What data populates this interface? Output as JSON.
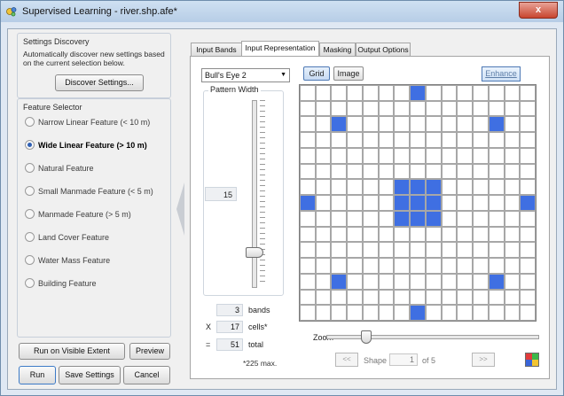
{
  "window": {
    "title": "Supervised Learning - river.shp.afe*",
    "close_label": "x"
  },
  "settings_discovery": {
    "title": "Settings Discovery",
    "description": "Automatically discover new settings based on the current selection below.",
    "button": "Discover Settings..."
  },
  "feature_selector": {
    "title": "Feature Selector",
    "items": [
      {
        "label": "Narrow Linear Feature (< 10 m)",
        "selected": false
      },
      {
        "label": "Wide Linear Feature (> 10 m)",
        "selected": true
      },
      {
        "label": "Natural Feature",
        "selected": false
      },
      {
        "label": "Small Manmade Feature (< 5 m)",
        "selected": false
      },
      {
        "label": "Manmade Feature (> 5 m)",
        "selected": false
      },
      {
        "label": "Land Cover Feature",
        "selected": false
      },
      {
        "label": "Water Mass Feature",
        "selected": false
      },
      {
        "label": "Building Feature",
        "selected": false
      }
    ]
  },
  "buttons": {
    "run_visible": "Run on Visible Extent",
    "preview": "Preview",
    "run": "Run",
    "save": "Save Settings",
    "cancel": "Cancel"
  },
  "tabs": [
    {
      "label": "Input Bands",
      "active": false
    },
    {
      "label": "Input Representation",
      "active": true
    },
    {
      "label": "Masking",
      "active": false
    },
    {
      "label": "Output Options",
      "active": false
    }
  ],
  "representation": {
    "pattern_select": "Bull's Eye 2",
    "pattern_width_label": "Pattern Width",
    "pattern_width_value": "15",
    "pattern_width_fraction": 0.17,
    "bands_value": "3",
    "bands_label": "bands",
    "cells_op": "X",
    "cells_value": "17",
    "cells_label": "cells*",
    "total_op": "=",
    "total_value": "51",
    "total_label": "total",
    "max_note": "*225 max.",
    "grid_button": "Grid",
    "image_button": "Image",
    "enhance_button": "Enhance",
    "grid_size": 15,
    "grid_on_cells": [
      [
        0,
        7
      ],
      [
        2,
        2
      ],
      [
        2,
        12
      ],
      [
        6,
        6
      ],
      [
        6,
        7
      ],
      [
        6,
        8
      ],
      [
        7,
        0
      ],
      [
        7,
        6
      ],
      [
        7,
        7
      ],
      [
        7,
        8
      ],
      [
        7,
        14
      ],
      [
        8,
        6
      ],
      [
        8,
        7
      ],
      [
        8,
        8
      ],
      [
        12,
        2
      ],
      [
        12,
        12
      ],
      [
        14,
        7
      ]
    ],
    "zoom_label": "Zoom",
    "zoom_fraction": 0.17,
    "pager": {
      "prev": "<<",
      "shape_label": "Shape",
      "shape_value": "1",
      "of_label": "of 5",
      "next": ">>"
    }
  },
  "colors": {
    "cell_on": "#3f6fe2",
    "cell_off": "#ffffff",
    "grid_line": "#a7a7a7"
  },
  "icons": {
    "app": "supervised-learning-icon",
    "palette": "color-palette-icon",
    "dropdown": "chevron-down-icon"
  }
}
